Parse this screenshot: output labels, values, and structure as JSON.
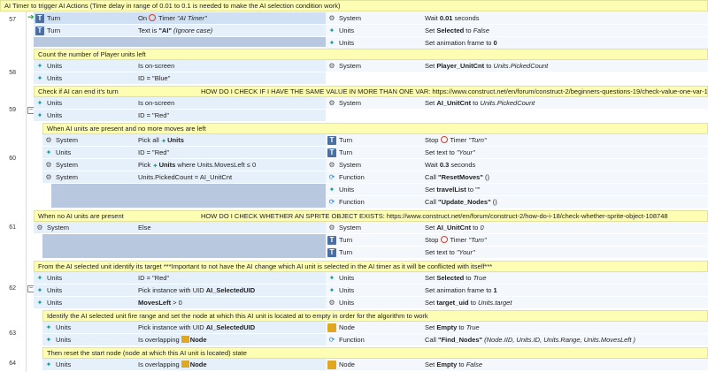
{
  "comments": {
    "c57": "AI Timer to trigger AI Actions (Time delay in range of 0.01 to 0.1 is needed to make the AI selection condition work)",
    "c58": "Count the number of Player units left",
    "c59": "Check if AI can end it's turn",
    "c59url": "HOW DO I CHECK IF I HAVE THE SAME VALUE IN MORE THAN ONE VAR: https://www.construct.net/en/forum/construct-2/beginners-questions-19/check-value-one-var-122508",
    "c60": "When AI units are present and no more moves are left",
    "c61": "When no AI units are present",
    "c61url": "HOW DO I CHECK WHETHER AN SPRITE OBJECT EXISTS: https://www.construct.net/en/forum/construct-2/how-do-i-18/check-whether-sprite-object-108748",
    "c62": "From the AI selected unit identify its target ***Important to not have the AI change which AI unit is selected in the AI timer as it will be conflicted with itself***",
    "c63": "Identify the AI selected unit fire range and set the node at which this AI unit is located at to empty in order for the algorithm to work",
    "c64": "Then reset the start node (node at which this AI unit is located) state"
  },
  "lines": [
    "57",
    "58",
    "59",
    "60",
    "61",
    "62",
    "63",
    "64"
  ],
  "e57": {
    "c1_obj": "Turn",
    "c1_a": "On ",
    "c1_b": "Timer ",
    "c1_c": "\"AI Timer\"",
    "c2_obj": "Turn",
    "c2_a": "Text is ",
    "c2_b": "\"AI\"",
    "c2_c": " (Ignore case)",
    "a1_obj": "System",
    "a1_a": "Wait ",
    "a1_b": "0.01",
    "a1_c": " seconds",
    "a2_obj": "Units",
    "a2_a": "Set ",
    "a2_b": "Selected",
    "a2_c": " to ",
    "a2_d": "False",
    "a3_obj": "Units",
    "a3_a": "Set animation frame to ",
    "a3_b": "0"
  },
  "e58": {
    "c1_obj": "Units",
    "c1_a": "Is on-screen",
    "c2_obj": "Units",
    "c2_a": "ID = \"Blue\"",
    "a1_obj": "System",
    "a1_a": "Set ",
    "a1_b": "Player_UnitCnt",
    "a1_c": " to ",
    "a1_d": "Units.PickedCount"
  },
  "e59": {
    "c1_obj": "Units",
    "c1_a": "Is on-screen",
    "c2_obj": "Units",
    "c2_a": "ID = \"Red\"",
    "a1_obj": "System",
    "a1_a": "Set ",
    "a1_b": "AI_UnitCnt",
    "a1_c": " to ",
    "a1_d": "Units.PickedCount"
  },
  "e60": {
    "c1_obj": "System",
    "c1_a": "Pick all ",
    "c1_b": "Units",
    "c2_obj": "Units",
    "c2_a": "ID = \"Red\"",
    "c3_obj": "System",
    "c3_a": "Pick ",
    "c3_b": "Units",
    "c3_c": " where Units.MovesLeft ≤ 0",
    "c4_obj": "System",
    "c4_a": "Units.PickedCount = AI_UnitCnt",
    "a1_obj": "Turn",
    "a1_a": "Stop ",
    "a1_b": "Timer ",
    "a1_c": "\"Turn\"",
    "a2_obj": "Turn",
    "a2_a": "Set text to ",
    "a2_b": "\"Your\"",
    "a3_obj": "System",
    "a3_a": "Wait ",
    "a3_b": "0.3",
    "a3_c": " seconds",
    "a4_obj": "Function",
    "a4_a": "Call ",
    "a4_b": "\"ResetMoves\"",
    "a4_c": " ()",
    "a5_obj": "Units",
    "a5_a": "Set ",
    "a5_b": "travelList",
    "a5_c": " to \"\"",
    "a6_obj": "Function",
    "a6_a": "Call ",
    "a6_b": "\"Update_Nodes\"",
    "a6_c": " ()"
  },
  "e61": {
    "c1_obj": "System",
    "c1_a": "Else",
    "a1_obj": "System",
    "a1_a": "Set ",
    "a1_b": "AI_UnitCnt",
    "a1_c": " to ",
    "a1_d": "0",
    "a2_obj": "Turn",
    "a2_a": "Stop ",
    "a2_b": "Timer ",
    "a2_c": "\"Turn\"",
    "a3_obj": "Turn",
    "a3_a": "Set text to ",
    "a3_b": "\"Your\""
  },
  "e62": {
    "c1_obj": "Units",
    "c1_a": "ID = \"Red\"",
    "c2_obj": "Units",
    "c2_a": "Pick instance with UID ",
    "c2_b": "AI_SelectedUID",
    "c3_obj": "Units",
    "c3_a": "MovesLeft",
    "c3_b": " > 0",
    "a1_obj": "Units",
    "a1_a": "Set ",
    "a1_b": "Selected",
    "a1_c": " to ",
    "a1_d": "True",
    "a2_obj": "Units",
    "a2_a": "Set animation frame to ",
    "a2_b": "1",
    "a3_obj": "Units",
    "a3_a": "Set ",
    "a3_b": "target_uid",
    "a3_c": " to ",
    "a3_d": "Units.target"
  },
  "e63": {
    "c1_obj": "Units",
    "c1_a": "Pick instance with UID ",
    "c1_b": "AI_SelectedUID",
    "c2_obj": "Units",
    "c2_a": "Is overlapping ",
    "c2_b": "Node",
    "a1_obj": "Node",
    "a1_a": "Set ",
    "a1_b": "Empty",
    "a1_c": " to ",
    "a1_d": "True",
    "a2_obj": "Function",
    "a2_a": "Call ",
    "a2_b": "\"Find_Nodes\"",
    "a2_c": " (Node.IID, Units.ID, Units.Range, Units.MovesLeft )"
  },
  "e64": {
    "c1_obj": "Units",
    "c1_a": "Is overlapping ",
    "c1_b": "Node",
    "a1_obj": "Node",
    "a1_a": "Set ",
    "a1_b": "Empty",
    "a1_c": " to ",
    "a1_d": "False"
  },
  "icons": {
    "system": "gear-icon",
    "units": "units-icon",
    "turn": "text-object-icon",
    "function": "function-icon",
    "node": "node-sprite-icon",
    "timer": "timer-icon"
  }
}
